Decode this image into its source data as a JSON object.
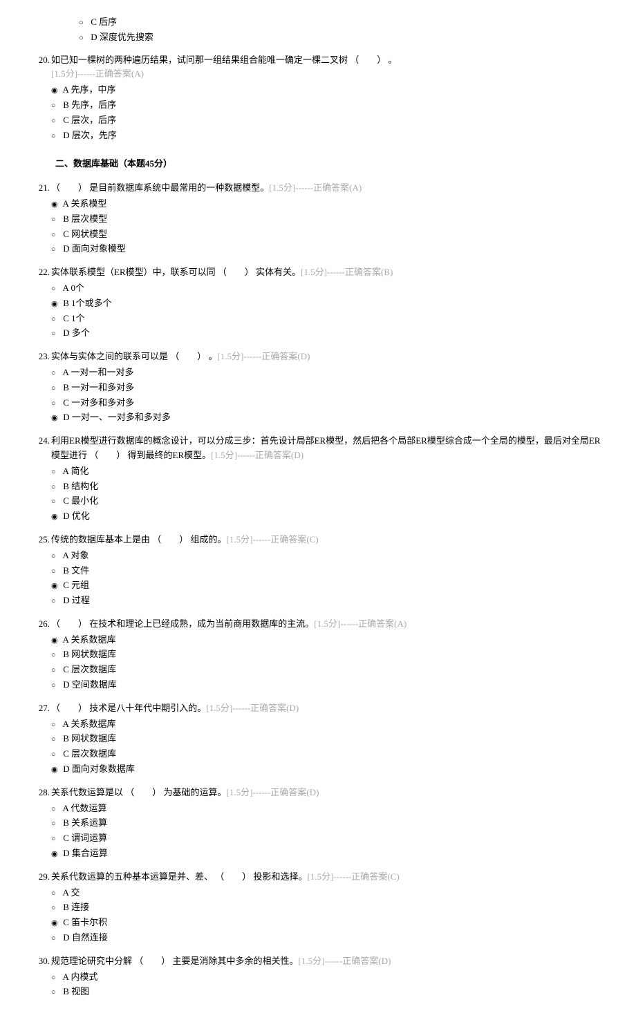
{
  "orphan_options": [
    {
      "label": "C",
      "text": " 后序",
      "selected": false
    },
    {
      "label": "D",
      "text": " 深度优先搜索",
      "selected": false
    }
  ],
  "section_title": "二、数据库基础（本题45分）",
  "questions": [
    {
      "num": "20.",
      "text": "如已知一棵树的两种遍历结果，试问那一组结果组合能唯一确定一棵二叉树 （　　） 。",
      "meta": "[1.5分]------正确答案(A)",
      "meta_newline": true,
      "options": [
        {
          "label": "A",
          "text": " 先序，中序",
          "selected": true
        },
        {
          "label": "B",
          "text": " 先序，后序",
          "selected": false
        },
        {
          "label": "C",
          "text": " 层次，后序",
          "selected": false
        },
        {
          "label": "D",
          "text": " 层次，先序",
          "selected": false
        }
      ]
    },
    {
      "num": "21.",
      "text": "（　　） 是目前数据库系统中最常用的一种数据模型。",
      "meta": "[1.5分]------正确答案(A)",
      "options": [
        {
          "label": "A",
          "text": " 关系模型",
          "selected": true
        },
        {
          "label": "B",
          "text": " 层次模型",
          "selected": false
        },
        {
          "label": "C",
          "text": " 网状模型",
          "selected": false
        },
        {
          "label": "D",
          "text": " 面向对象模型",
          "selected": false
        }
      ]
    },
    {
      "num": "22.",
      "text": "实体联系模型（ER模型）中，联系可以同 （　　） 实体有关。",
      "meta": "[1.5分]------正确答案(B)",
      "options": [
        {
          "label": "A",
          "text": " 0个",
          "selected": false
        },
        {
          "label": "B",
          "text": " 1个或多个",
          "selected": true
        },
        {
          "label": "C",
          "text": " 1个",
          "selected": false
        },
        {
          "label": "D",
          "text": " 多个",
          "selected": false
        }
      ]
    },
    {
      "num": "23.",
      "text": "实体与实体之间的联系可以是 （　　） 。",
      "meta": "[1.5分]------正确答案(D)",
      "options": [
        {
          "label": "A",
          "text": " 一对一和一对多",
          "selected": false
        },
        {
          "label": "B",
          "text": " 一对一和多对多",
          "selected": false
        },
        {
          "label": "C",
          "text": " 一对多和多对多",
          "selected": false
        },
        {
          "label": "D",
          "text": " 一对一、一对多和多对多",
          "selected": true
        }
      ]
    },
    {
      "num": "24.",
      "text": "利用ER模型进行数据库的概念设计，可以分成三步：首先设计局部ER模型，然后把各个局部ER模型综合成一个全局的模型，最后对全局ER模型进行 （　　） 得到最终的ER模型。",
      "meta": "[1.5分]------正确答案(D)",
      "options": [
        {
          "label": "A",
          "text": " 简化",
          "selected": false
        },
        {
          "label": "B",
          "text": " 结构化",
          "selected": false
        },
        {
          "label": "C",
          "text": " 最小化",
          "selected": false
        },
        {
          "label": "D",
          "text": " 优化",
          "selected": true
        }
      ]
    },
    {
      "num": "25.",
      "text": "传统的数据库基本上是由 （　　） 组成的。",
      "meta": "[1.5分]------正确答案(C)",
      "options": [
        {
          "label": "A",
          "text": " 对象",
          "selected": false
        },
        {
          "label": "B",
          "text": " 文件",
          "selected": false
        },
        {
          "label": "C",
          "text": " 元组",
          "selected": true
        },
        {
          "label": "D",
          "text": " 过程",
          "selected": false
        }
      ]
    },
    {
      "num": "26.",
      "text": "（　　） 在技术和理论上已经成熟，成为当前商用数据库的主流。",
      "meta": "[1.5分]------正确答案(A)",
      "options": [
        {
          "label": "A",
          "text": " 关系数据库",
          "selected": true
        },
        {
          "label": "B",
          "text": " 网状数据库",
          "selected": false
        },
        {
          "label": "C",
          "text": " 层次数据库",
          "selected": false
        },
        {
          "label": "D",
          "text": " 空间数据库",
          "selected": false
        }
      ]
    },
    {
      "num": "27.",
      "text": "（　　） 技术是八十年代中期引入的。",
      "meta": "[1.5分]------正确答案(D)",
      "options": [
        {
          "label": "A",
          "text": " 关系数据库",
          "selected": false
        },
        {
          "label": "B",
          "text": " 网状数据库",
          "selected": false
        },
        {
          "label": "C",
          "text": " 层次数据库",
          "selected": false
        },
        {
          "label": "D",
          "text": " 面向对象数据库",
          "selected": true
        }
      ]
    },
    {
      "num": "28.",
      "text": "关系代数运算是以 （　　） 为基础的运算。",
      "meta": "[1.5分]------正确答案(D)",
      "options": [
        {
          "label": "A",
          "text": " 代数运算",
          "selected": false
        },
        {
          "label": "B",
          "text": " 关系运算",
          "selected": false
        },
        {
          "label": "C",
          "text": " 谓词运算",
          "selected": false
        },
        {
          "label": "D",
          "text": " 集合运算",
          "selected": true
        }
      ]
    },
    {
      "num": "29.",
      "text": "关系代数运算的五种基本运算是并、差、 （　　） 投影和选择。",
      "meta": "[1.5分]------正确答案(C)",
      "options": [
        {
          "label": "A",
          "text": " 交",
          "selected": false
        },
        {
          "label": "B",
          "text": " 连接",
          "selected": false
        },
        {
          "label": "C",
          "text": " 笛卡尔积",
          "selected": true
        },
        {
          "label": "D",
          "text": " 自然连接",
          "selected": false
        }
      ]
    },
    {
      "num": "30.",
      "text": "规范理论研究中分解 （　　） 主要是消除其中多余的相关性。",
      "meta": "[1.5分]------正确答案(D)",
      "options": [
        {
          "label": "A",
          "text": " 内模式",
          "selected": false
        },
        {
          "label": "B",
          "text": " 视图",
          "selected": false
        }
      ]
    }
  ]
}
